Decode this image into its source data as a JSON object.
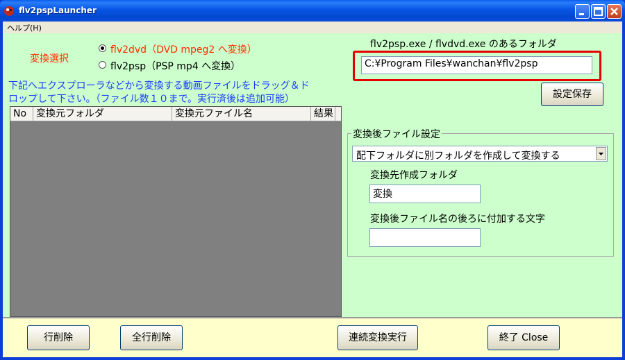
{
  "window": {
    "title": "flv2pspLauncher",
    "minimize_label": "_",
    "maximize_label": "□",
    "close_label": "×"
  },
  "menu": {
    "help": "ヘルプ(H)"
  },
  "conversion": {
    "label": "変換選択",
    "options": [
      {
        "label": "flv2dvd（DVD mpeg2 へ変換）",
        "selected": true
      },
      {
        "label": "flv2psp（PSP mp4 へ変換）",
        "selected": false
      }
    ]
  },
  "instructions": {
    "line1": "下記へエクスプローラなどから変換する動画ファイルをドラッグ＆ド",
    "line2": "ロップして下さい。（ファイル数１０まで。実行済後は追加可能）"
  },
  "list": {
    "columns": [
      "No",
      "変換元フォルダ",
      "変換元ファイル名",
      "結果"
    ],
    "rows": []
  },
  "exe_folder": {
    "label": "flv2psp.exe / flvdvd.exe のあるフォルダ",
    "value": "C:¥Program Files¥wanchan¥flv2psp"
  },
  "save_settings_button": "設定保存",
  "output_settings": {
    "title": "変換後ファイル設定",
    "mode_selected": "配下フォルダに別フォルダを作成して変換する",
    "dest_folder_label": "変換先作成フォルダ",
    "dest_folder_value": "変換",
    "suffix_label": "変換後ファイル名の後ろに付加する文字",
    "suffix_value": ""
  },
  "buttons": {
    "delete_row": "行削除",
    "delete_all": "全行削除",
    "run_batch": "連続変換実行",
    "close": "終了 Close"
  },
  "colors": {
    "client_bg": "#ccffcc",
    "bottom_bg": "#ffffcc",
    "accent_red": "#ff2a00",
    "instruction_blue": "#1a3cff",
    "highlight": "#e60000"
  }
}
